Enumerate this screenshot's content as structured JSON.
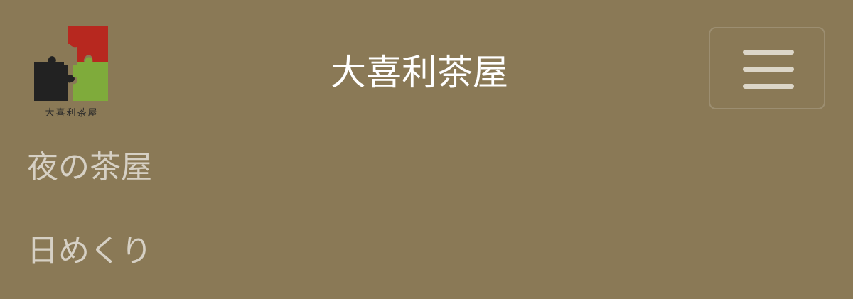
{
  "header": {
    "logo_text": "大喜利茶屋",
    "title": "大喜利茶屋",
    "menu_icon": "hamburger-menu-icon"
  },
  "nav": {
    "items": [
      {
        "label": "夜の茶屋"
      },
      {
        "label": "日めくり"
      }
    ]
  },
  "colors": {
    "background": "#8a7956",
    "logo_red": "#b7281f",
    "logo_black": "#222222",
    "logo_green": "#7fab3b"
  }
}
